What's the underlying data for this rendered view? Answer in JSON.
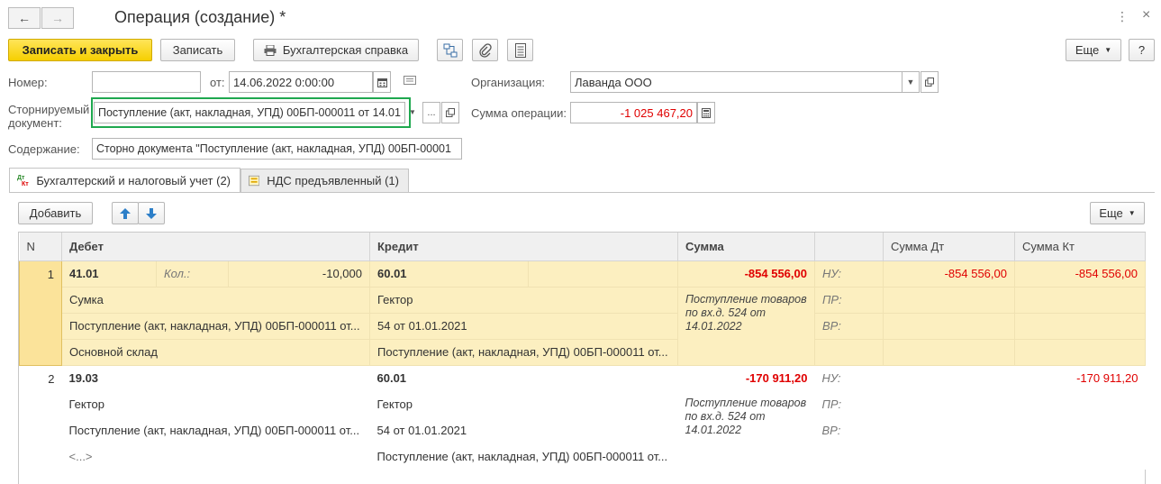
{
  "window": {
    "title": "Операция (создание) *",
    "back_icon": "arrow-left-icon",
    "forward_icon": "arrow-right-icon",
    "more_icon": "vertical-dots-icon",
    "close_icon": "close-icon",
    "close_glyph": "×",
    "more_glyph": "⋮"
  },
  "toolbar": {
    "save_close": "Записать и закрыть",
    "save": "Записать",
    "accounting_note": "Бухгалтерская справка",
    "more": "Еще",
    "help": "?"
  },
  "form": {
    "number_label": "Номер:",
    "number_value": "",
    "from_label": "от:",
    "date_value": "14.06.2022  0:00:00",
    "org_label": "Организация:",
    "org_value": "Лаванда ООО",
    "storno_label_1": "Сторнируемый",
    "storno_label_2": "документ:",
    "storno_value": "Поступление (акт, накладная, УПД) 00БП-000011 от 14.01",
    "storno_dots": "...",
    "sum_label": "Сумма операции:",
    "sum_value": "-1 025 467,20",
    "content_label": "Содержание:",
    "content_value": "Сторно документа \"Поступление (акт, накладная, УПД) 00БП-00001"
  },
  "tabs": [
    {
      "label": "Бухгалтерский и налоговый учет (2)",
      "icon": "dt-kt-icon",
      "icon_top": "Дт",
      "icon_bottom": "Кт"
    },
    {
      "label": "НДС предъявленный (1)",
      "icon": "vat-doc-icon"
    }
  ],
  "table_toolbar": {
    "add": "Добавить",
    "more": "Еще"
  },
  "table": {
    "headers": {
      "n": "N",
      "debit": "Дебет",
      "credit": "Кредит",
      "sum": "Сумма",
      "sum_dt": "Сумма Дт",
      "sum_kt": "Сумма Кт"
    },
    "rows": [
      {
        "n": "1",
        "debit_account": "41.01",
        "qty_label": "Кол.:",
        "qty_value": "-10,000",
        "credit_account": "60.01",
        "sum": "-854 556,00",
        "nu": "НУ:",
        "sum_dt": "-854 556,00",
        "sum_kt": "-854 556,00",
        "debit_sub1": "Сумка",
        "credit_sub1": "Гектор",
        "pr": "ПР:",
        "debit_sub2": "Поступление (акт, накладная, УПД) 00БП-000011 от...",
        "credit_sub2": "54 от 01.01.2021",
        "vr": "ВР:",
        "debit_sub3": "Основной склад",
        "credit_sub3": "Поступление (акт, накладная, УПД) 00БП-000011 от...",
        "description": "Поступление товаров по вх.д. 524 от 14.01.2022"
      },
      {
        "n": "2",
        "debit_account": "19.03",
        "credit_account": "60.01",
        "sum": "-170 911,20",
        "nu": "НУ:",
        "sum_kt": "-170 911,20",
        "debit_sub1": "Гектор",
        "credit_sub1": "Гектор",
        "pr": "ПР:",
        "debit_sub2": "Поступление (акт, накладная, УПД) 00БП-000011 от...",
        "credit_sub2": "54 от 01.01.2021",
        "vr": "ВР:",
        "debit_sub3": "<...>",
        "credit_sub3": "Поступление (акт, накладная, УПД) 00БП-000011 от...",
        "description": "Поступление товаров по вх.д. 524 от 14.01.2022"
      }
    ]
  },
  "colors": {
    "primary_button": "#f6cf00",
    "selected_row": "#fcefc0",
    "negative_value": "#e00000",
    "highlight_border": "#1fa84f"
  }
}
